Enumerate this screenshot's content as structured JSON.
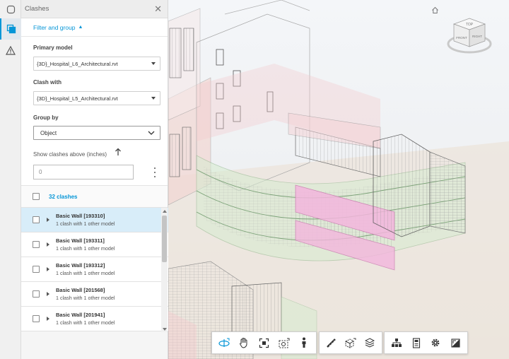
{
  "panel": {
    "title": "Clashes",
    "filter_toggle": "Filter and group",
    "primary_model_label": "Primary model",
    "primary_model_value": "{3D}_Hospital_L6_Architectural.rvt",
    "clash_with_label": "Clash with",
    "clash_with_value": "{3D}_Hospital_L5_Architectural.rvt",
    "group_by_label": "Group by",
    "group_by_value": "Object",
    "threshold_label": "Show clashes above (inches)",
    "threshold_value": "0",
    "count_label": "32 clashes"
  },
  "clashes": [
    {
      "name": "Basic Wall [193310]",
      "detail": "1 clash with 1 other model",
      "selected": true
    },
    {
      "name": "Basic Wall [193311]",
      "detail": "1 clash with 1 other model",
      "selected": false
    },
    {
      "name": "Basic Wall [193312]",
      "detail": "1 clash with 1 other model",
      "selected": false
    },
    {
      "name": "Basic Wall [201568]",
      "detail": "1 clash with 1 other model",
      "selected": false
    },
    {
      "name": "Basic Wall [201941]",
      "detail": "1 clash with 1 other model",
      "selected": false
    }
  ],
  "viewcube": {
    "top": "TOP",
    "front": "FRONT",
    "right": "RIGHT"
  },
  "toolbar_groups": [
    [
      "orbit-icon",
      "pan-icon",
      "fit-to-view-icon",
      "camera-icon",
      "first-person-icon"
    ],
    [
      "measure-icon",
      "section-icon",
      "layers-icon"
    ],
    [
      "model-browser-icon",
      "properties-icon",
      "settings-icon",
      "fullscreen-icon"
    ]
  ],
  "colors": {
    "accent": "#0696d7",
    "selected_row": "#d8edf9",
    "clash_pink": "#f3b6dd",
    "clash_green": "#cfe8c5"
  }
}
